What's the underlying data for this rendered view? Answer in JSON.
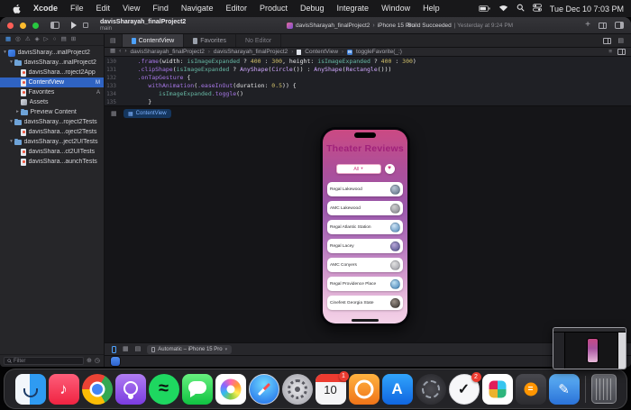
{
  "menubar": {
    "items": [
      "Xcode",
      "File",
      "Edit",
      "View",
      "Find",
      "Navigate",
      "Editor",
      "Product",
      "Debug",
      "Integrate",
      "Window",
      "Help"
    ],
    "time": "Tue Dec 10  7:03 PM"
  },
  "toolbar": {
    "project_title": "davisSharayah_finalProject2",
    "branch": "main",
    "scheme_app": "davisSharayah_finalProject2",
    "scheme_device": "iPhone 15 Pro",
    "build_status": "Build Succeeded",
    "build_detail": "| Yesterday at 9:24 PM"
  },
  "tabbar": {
    "tabs": [
      {
        "label": "ContentView"
      },
      {
        "label": "Favorites"
      },
      {
        "label": "No Editor"
      }
    ]
  },
  "jumpbar": {
    "crumbs": [
      "davisSharayah_finalProject2",
      "davisSharayah_finalProject2",
      "ContentView",
      "toggleFavorite(_:)"
    ]
  },
  "navigator": {
    "items": [
      {
        "label": "davisSharay...inalProject2"
      },
      {
        "label": "davisSharay...inalProject2"
      },
      {
        "label": "davisShara...roject2App"
      },
      {
        "label": "ContentView",
        "badge": "M"
      },
      {
        "label": "Favorites",
        "badge": "A"
      },
      {
        "label": "Assets"
      },
      {
        "label": "Preview Content"
      },
      {
        "label": "davisSharay...roject2Tests"
      },
      {
        "label": "davisShara...oject2Tests"
      },
      {
        "label": "davisSharay...ject2UITests"
      },
      {
        "label": "davisShara...ct2UITests"
      },
      {
        "label": "davisShara...aunchTests"
      }
    ],
    "filter_placeholder": "Filter"
  },
  "editor": {
    "lines": [
      {
        "num": "130",
        "tokens": [
          {
            "c": "pl",
            "t": "     "
          },
          {
            "c": "fn",
            "t": ".frame"
          },
          {
            "c": "pl",
            "t": "(width: "
          },
          {
            "c": "prop",
            "t": "isImageExpanded"
          },
          {
            "c": "pl",
            "t": " ? "
          },
          {
            "c": "num",
            "t": "400"
          },
          {
            "c": "pl",
            "t": " : "
          },
          {
            "c": "num",
            "t": "300"
          },
          {
            "c": "pl",
            "t": ", height: "
          },
          {
            "c": "prop",
            "t": "isImageExpanded"
          },
          {
            "c": "pl",
            "t": " ? "
          },
          {
            "c": "num",
            "t": "400"
          },
          {
            "c": "pl",
            "t": " : "
          },
          {
            "c": "num",
            "t": "300"
          },
          {
            "c": "pl",
            "t": ")"
          }
        ]
      },
      {
        "num": "131",
        "tokens": [
          {
            "c": "pl",
            "t": "     "
          },
          {
            "c": "fn",
            "t": ".clipShape"
          },
          {
            "c": "pl",
            "t": "("
          },
          {
            "c": "prop",
            "t": "isImageExpanded"
          },
          {
            "c": "pl",
            "t": " ? "
          },
          {
            "c": "type",
            "t": "AnyShape"
          },
          {
            "c": "pl",
            "t": "("
          },
          {
            "c": "type",
            "t": "Circle"
          },
          {
            "c": "pl",
            "t": "()) : "
          },
          {
            "c": "type",
            "t": "AnyShape"
          },
          {
            "c": "pl",
            "t": "("
          },
          {
            "c": "type",
            "t": "Rectangle"
          },
          {
            "c": "pl",
            "t": "()))"
          }
        ]
      },
      {
        "num": "132",
        "tokens": [
          {
            "c": "pl",
            "t": "     "
          },
          {
            "c": "fn",
            "t": ".onTapGesture"
          },
          {
            "c": "pl",
            "t": " {"
          }
        ]
      },
      {
        "num": "133",
        "tokens": [
          {
            "c": "pl",
            "t": "        "
          },
          {
            "c": "fn",
            "t": "withAnimation"
          },
          {
            "c": "pl",
            "t": "("
          },
          {
            "c": "fn",
            "t": ".easeInOut"
          },
          {
            "c": "pl",
            "t": "(duration: "
          },
          {
            "c": "num",
            "t": "0.5"
          },
          {
            "c": "pl",
            "t": ")) {"
          }
        ]
      },
      {
        "num": "134",
        "tokens": [
          {
            "c": "pl",
            "t": "           "
          },
          {
            "c": "prop",
            "t": "isImageExpanded"
          },
          {
            "c": "fn",
            "t": ".toggle"
          },
          {
            "c": "pl",
            "t": "()"
          }
        ]
      },
      {
        "num": "135",
        "tokens": [
          {
            "c": "pl",
            "t": "        }"
          }
        ]
      }
    ]
  },
  "canvas": {
    "preview_pill": "ContentView",
    "device_selector": "Automatic – iPhone 15 Pro"
  },
  "preview_app": {
    "title": "Theater Reviews",
    "filter_value": "All",
    "theaters": [
      "Regal Lakewood",
      "AMC Lakewood",
      "Regal Atlantic Station",
      "Regal Lacey",
      "AMC Conyers",
      "Regal Providence Place",
      "Cinefest Georgia State"
    ]
  },
  "jumpbar_symbol": "M",
  "dock": {
    "apps": [
      "Finder",
      "Music",
      "Chrome",
      "Podcasts",
      "Spotify",
      "Messages",
      "Photos",
      "Safari",
      "System Settings",
      "Calendar",
      "Orange App",
      "App Store",
      "Privacy App",
      "Checkmark App",
      "Slack",
      "Calculator",
      "Pencil App",
      "Trash"
    ],
    "calendar_date": "10",
    "badges": {
      "calendar": "1",
      "checkmark": "2"
    }
  },
  "colors": {
    "accent_blue": "#4da2ff",
    "selection_blue": "#2f63c2",
    "phone_pink": "#cb4a83",
    "title_magenta": "#a0217a"
  }
}
